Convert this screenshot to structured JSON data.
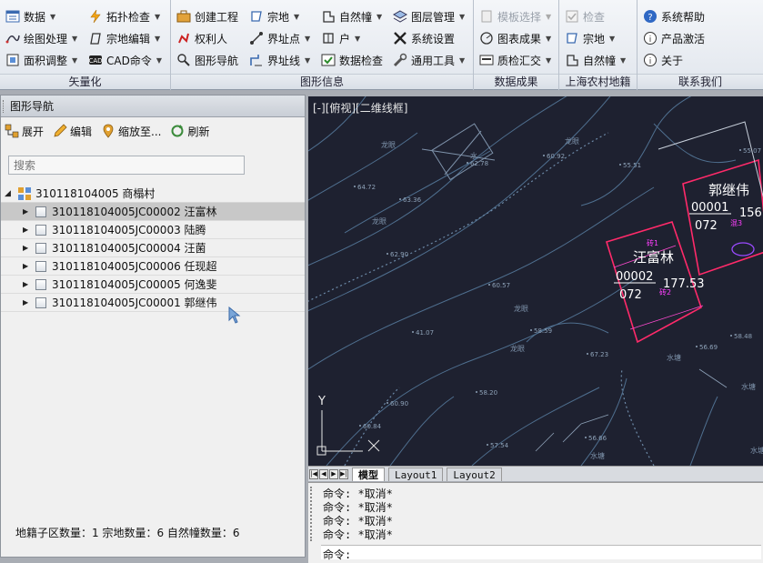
{
  "ribbon": {
    "groups": [
      {
        "title": "矢量化",
        "items": [
          {
            "label": "数据",
            "icon": "data-icon",
            "dropdown": true
          },
          {
            "label": "绘图处理",
            "icon": "draw-process-icon",
            "dropdown": true
          },
          {
            "label": "面积调整",
            "icon": "area-adjust-icon",
            "dropdown": true
          },
          {
            "label": "拓扑检查",
            "icon": "topology-check-icon",
            "dropdown": true
          },
          {
            "label": "宗地编辑",
            "icon": "parcel-edit-icon",
            "dropdown": true
          },
          {
            "label": "CAD命令",
            "icon": "cad-command-icon",
            "dropdown": true
          }
        ]
      },
      {
        "title": "图形信息",
        "items": [
          {
            "label": "创建工程",
            "icon": "create-project-icon",
            "dropdown": false
          },
          {
            "label": "权利人",
            "icon": "owner-icon",
            "dropdown": false
          },
          {
            "label": "图形导航",
            "icon": "graphic-nav-icon",
            "dropdown": false
          },
          {
            "label": "宗地",
            "icon": "parcel-icon",
            "dropdown": true
          },
          {
            "label": "界址点",
            "icon": "boundary-point-icon",
            "dropdown": true
          },
          {
            "label": "界址线",
            "icon": "boundary-line-icon",
            "dropdown": true
          },
          {
            "label": "自然幢",
            "icon": "natural-building-icon",
            "dropdown": true
          },
          {
            "label": "户",
            "icon": "household-icon",
            "dropdown": true
          },
          {
            "label": "数据检查",
            "icon": "data-check-icon",
            "dropdown": false
          },
          {
            "label": "图层管理",
            "icon": "layer-manage-icon",
            "dropdown": true
          },
          {
            "label": "系统设置",
            "icon": "settings-icon",
            "dropdown": false
          },
          {
            "label": "通用工具",
            "icon": "tools-icon",
            "dropdown": true
          }
        ]
      },
      {
        "title": "数据成果",
        "items": [
          {
            "label": "模板选择",
            "icon": "template-icon",
            "dropdown": true,
            "disabled": true
          },
          {
            "label": "图表成果",
            "icon": "chart-result-icon",
            "dropdown": true
          },
          {
            "label": "质检汇交",
            "icon": "quality-submit-icon",
            "dropdown": true
          }
        ]
      },
      {
        "title": "上海农村地籍",
        "items": [
          {
            "label": "检查",
            "icon": "check-icon",
            "dropdown": false,
            "disabled": true
          },
          {
            "label": "宗地",
            "icon": "parcel-icon",
            "dropdown": true
          },
          {
            "label": "自然幢",
            "icon": "natural-building-icon",
            "dropdown": true
          }
        ]
      },
      {
        "title": "联系我们",
        "items": [
          {
            "label": "系统帮助",
            "icon": "help-icon",
            "dropdown": false
          },
          {
            "label": "产品激活",
            "icon": "activate-icon",
            "dropdown": false
          },
          {
            "label": "关于",
            "icon": "about-icon",
            "dropdown": false
          }
        ]
      }
    ]
  },
  "nav_panel": {
    "title": "图形导航",
    "toolbar": [
      {
        "label": "展开",
        "icon": "expand-icon"
      },
      {
        "label": "编辑",
        "icon": "edit-pencil-icon"
      },
      {
        "label": "缩放至...",
        "icon": "zoom-to-icon"
      },
      {
        "label": "刷新",
        "icon": "refresh-icon"
      }
    ],
    "search_placeholder": "搜索",
    "root": "310118104005 商榻村",
    "nodes": [
      "310118104005JC00002 汪富林",
      "310118104005JC00003 陆腾",
      "310118104005JC00004 汪菌",
      "310118104005JC00006 任现超",
      "310118104005JC00005 何逸斐",
      "310118104005JC00001 郭继伟"
    ],
    "selected_index": 0,
    "status": "地籍子区数量：1 宗地数量：6 自然幢数量：6"
  },
  "cad": {
    "viewport_label": "[-][俯视][二维线框]",
    "labels": {
      "owner1": "汪富林",
      "num1": "00002",
      "code1": "072",
      "area1": "177.53",
      "owner2": "郭继伟",
      "num2": "00001",
      "code2": "072",
      "area2": "156.",
      "axis_y": "Y",
      "bd1": "砖1",
      "bd2": "砖2",
      "bd3": "混3"
    },
    "elevations": [
      "62.78",
      "64.72",
      "60.92",
      "63.36",
      "62.90",
      "60.57",
      "41.07",
      "58.59",
      "60.90",
      "60.84",
      "57.54",
      "56.66",
      "67.23",
      "58.20",
      "55.51",
      "55.07",
      "56.69",
      "58.48"
    ],
    "tags": [
      "水",
      "龙眼",
      "龙眼",
      "龙眼",
      "龙眼",
      "龙眼",
      "水塘",
      "水塘",
      "水塘",
      "水塘"
    ],
    "tabs": [
      "模型",
      "Layout1",
      "Layout2"
    ],
    "active_tab": "模型",
    "command_history": [
      "命令: *取消*",
      "命令: *取消*",
      "命令: *取消*",
      "命令: *取消*"
    ],
    "prompt": "命令:"
  }
}
